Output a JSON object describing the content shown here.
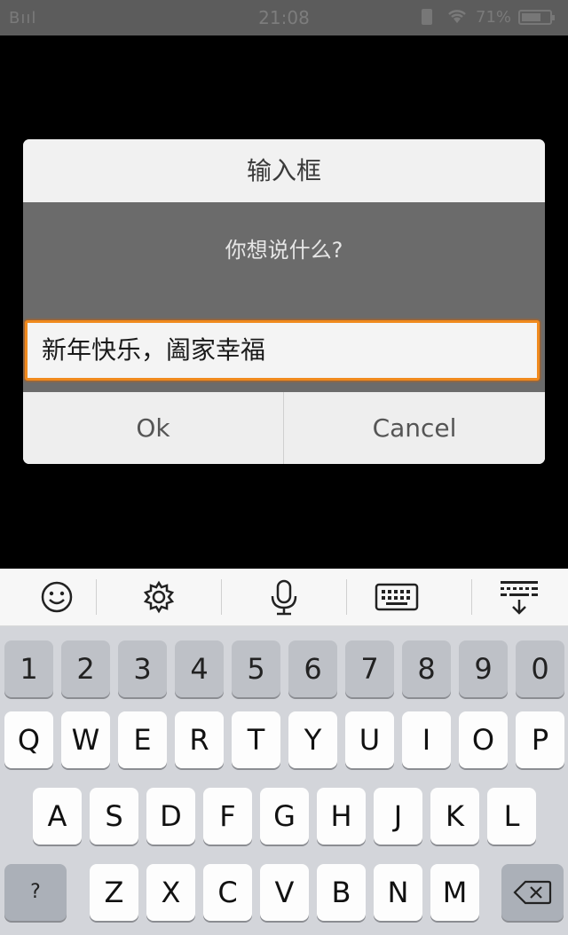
{
  "status_bar": {
    "signal": "Bııl",
    "time": "21:08",
    "battery_percent": "71%",
    "battery_level": 0.71
  },
  "dialog": {
    "title": "输入框",
    "message": "你想说什么?",
    "input_value": "新年快乐，阖家幸福",
    "ok_label": "Ok",
    "cancel_label": "Cancel",
    "accent_color": "#f08a1e"
  },
  "toolbar": {
    "items": [
      "smiley-icon",
      "gear-icon",
      "microphone-icon",
      "keyboard-icon",
      "keyboard-hide-icon"
    ]
  },
  "keyboard": {
    "row_numbers": [
      "1",
      "2",
      "3",
      "4",
      "5",
      "6",
      "7",
      "8",
      "9",
      "0"
    ],
    "row1": [
      "Q",
      "W",
      "E",
      "R",
      "T",
      "Y",
      "U",
      "I",
      "O",
      "P"
    ],
    "row2": [
      "A",
      "S",
      "D",
      "F",
      "G",
      "H",
      "J",
      "K",
      "L"
    ],
    "row3": [
      "Z",
      "X",
      "C",
      "V",
      "B",
      "N",
      "M"
    ],
    "symbol_key": "?",
    "backspace_icon": "backspace-icon"
  }
}
